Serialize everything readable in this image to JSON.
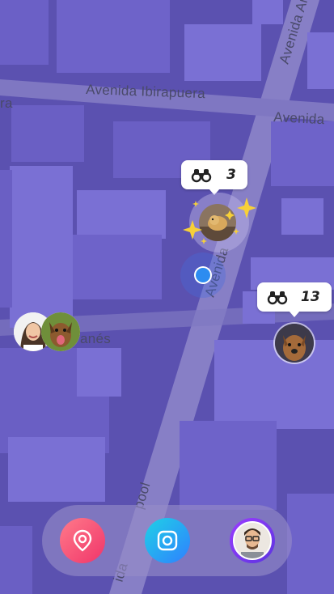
{
  "map": {
    "streets": {
      "ibirapuera": "Avenida Ibirapuera",
      "left_partial": "ra",
      "right_partial": "Avenida",
      "top_vertical": "Avenida Ar",
      "center_vertical": "Avenida",
      "lower_left_partial": "anés",
      "lower_vertical": "pool",
      "bottom_vertical": "ida"
    }
  },
  "clusters": [
    {
      "id": "center",
      "count": "3",
      "icon": "binoculars-icon",
      "highlighted": true
    },
    {
      "id": "right",
      "count": "13",
      "icon": "binoculars-icon",
      "highlighted": false
    }
  ],
  "colors": {
    "map_base": "#5b51b0",
    "building_top": "#7d72d6",
    "building_side": "#6a5fc4",
    "street": "#8a82c8",
    "map_button": "#f0356a",
    "camera_button": "#2f80ff",
    "profile_ring": "#9b3cff",
    "user_dot": "#2d8cf0",
    "sparkle": "#f7d038"
  },
  "dock": {
    "map_button_icon": "map-pin-icon",
    "camera_button_icon": "camera-icon",
    "profile_icon": "profile-avatar"
  }
}
